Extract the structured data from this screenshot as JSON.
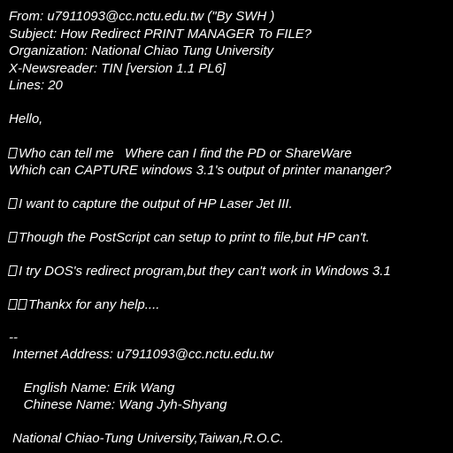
{
  "header": {
    "from": "From: u7911093@cc.nctu.edu.tw (\"By SWH )",
    "subject": "Subject: How Redirect PRINT MANAGER To FILE?",
    "organization": "Organization: National Chiao Tung University",
    "newsreader": "X-Newsreader: TIN [version 1.1 PL6]",
    "lines": "Lines: 20"
  },
  "body": {
    "greeting": "Hello,",
    "para1_line1": "Who can tell me   Where can I find the PD or ShareWare",
    "para1_line2": "Which can CAPTURE windows 3.1's output of printer mananger?",
    "para2": "I want to capture the output of HP Laser Jet III.",
    "para3": "Though the PostScript can setup to print to file,but HP can't.",
    "para4": "I try DOS's redirect program,but they can't work in Windows 3.1",
    "para5": "Thankx for any help...."
  },
  "signature": {
    "separator": "--",
    "internet_address": " Internet Address: u7911093@cc.nctu.edu.tw",
    "english_name": "    English Name: Erik Wang",
    "chinese_name": "    Chinese Name: Wang Jyh-Shyang",
    "affiliation": " National Chiao-Tung University,Taiwan,R.O.C."
  }
}
